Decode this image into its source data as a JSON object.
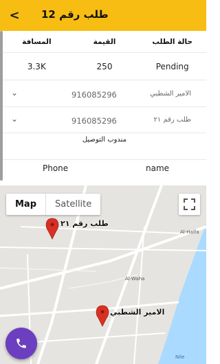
{
  "appbar": {
    "title": "طلب رقم 12",
    "back_icon": "chevron-left-icon"
  },
  "order_table": {
    "headers": [
      "المسافة",
      "القيمة",
      "حالة الطلب"
    ],
    "values": [
      "3.3K",
      "250",
      "Pending"
    ]
  },
  "contacts": [
    {
      "phone": "916085296",
      "name": "الامير الشطبي"
    },
    {
      "phone": "916085296",
      "name": "طلب رقم ٢١"
    }
  ],
  "courier_label": "مندوب التوصيل",
  "courier_table": {
    "phone_header": "Phone",
    "name_header": "name"
  },
  "map": {
    "type_options": [
      "Map",
      "Satellite"
    ],
    "selected_type": "Map",
    "markers": [
      {
        "label": "طلب رقم ٢١"
      },
      {
        "label": "الامير الشطبي"
      }
    ],
    "road_labels": [
      "Al-Halfa",
      "Al-Waha",
      "Nile"
    ],
    "marker_color": "#d93025"
  },
  "call_button": {
    "icon": "phone-icon",
    "color": "#6b3fbf"
  },
  "accent_color": "#f7bd12"
}
